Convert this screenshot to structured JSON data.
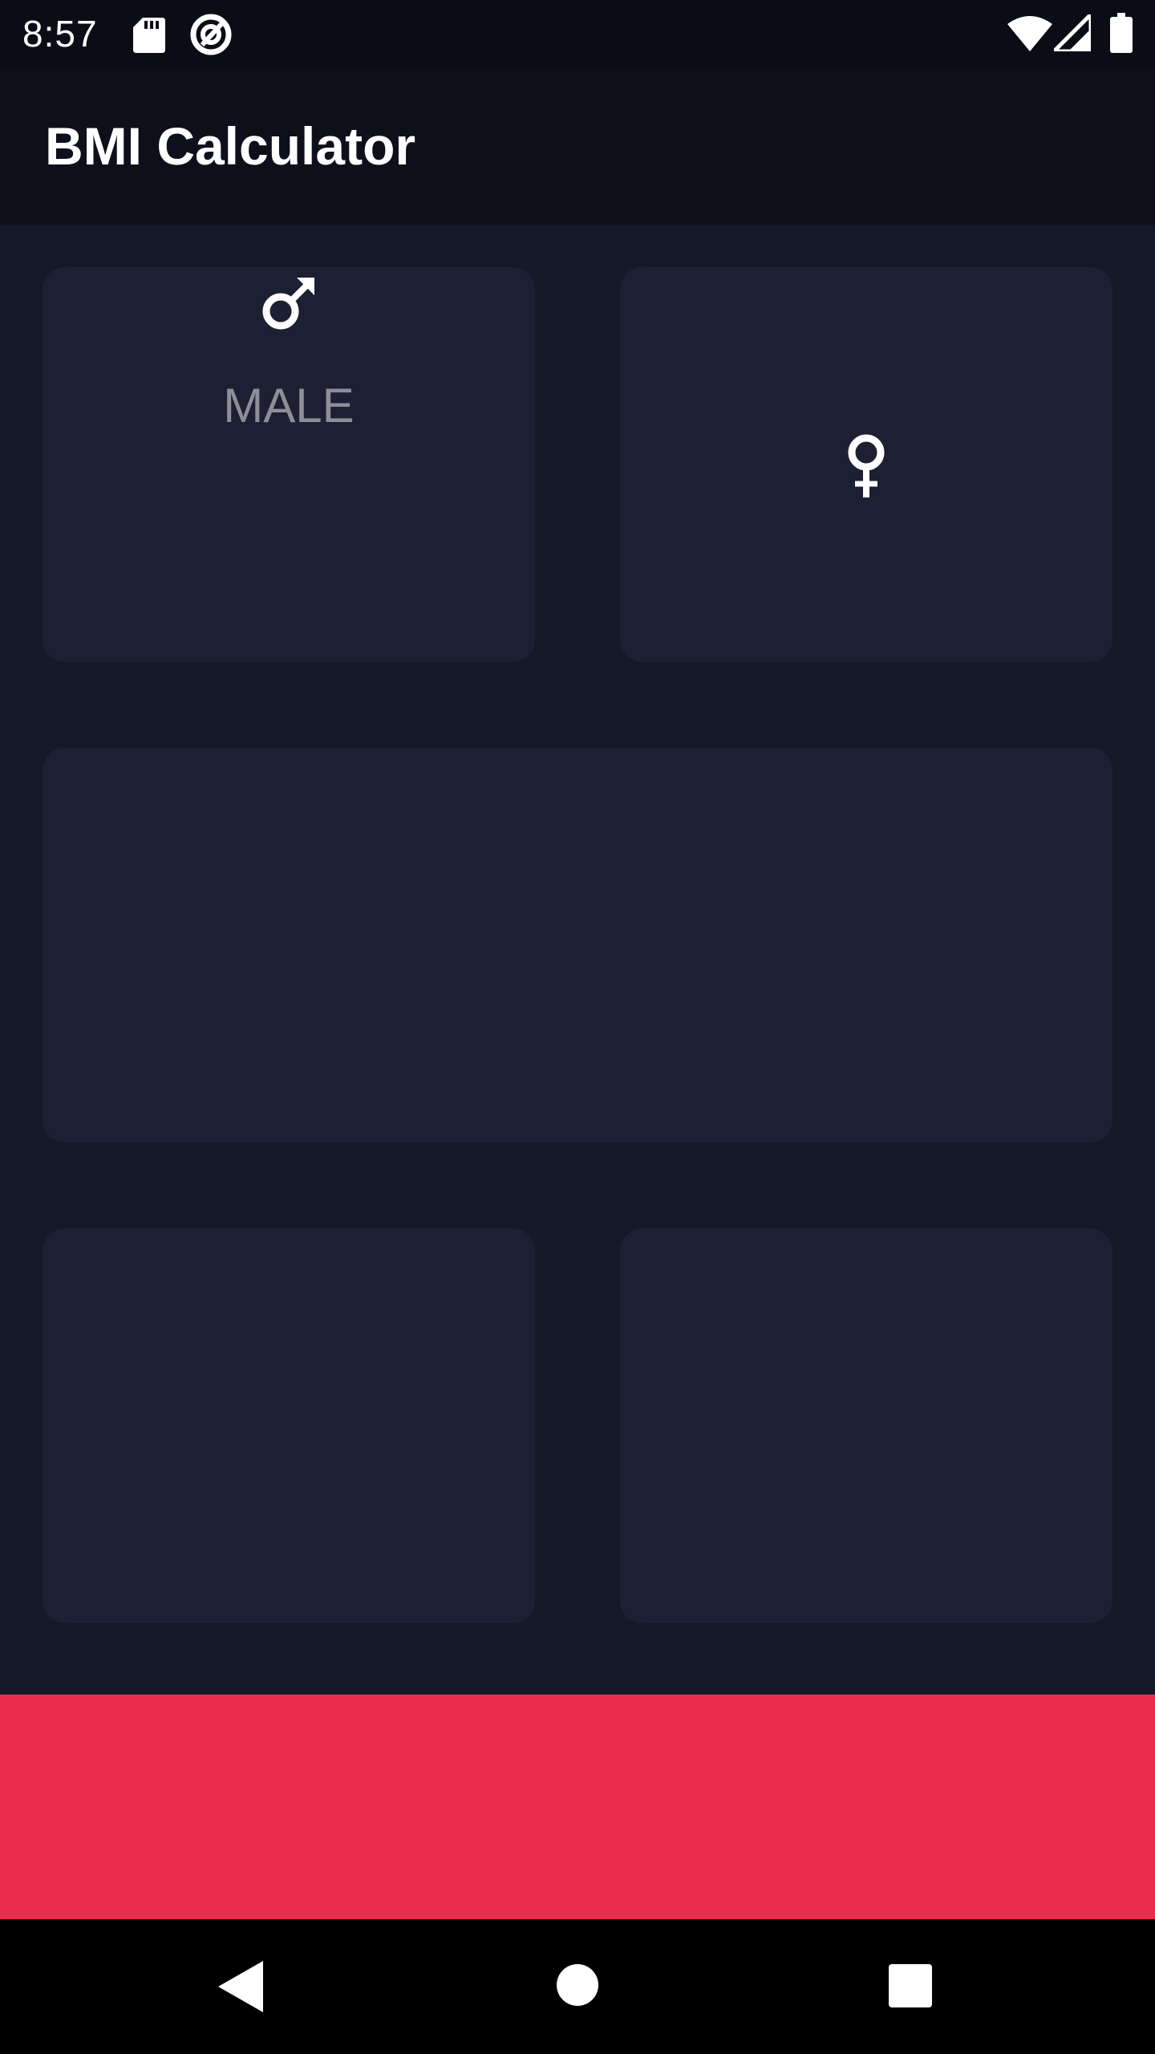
{
  "status_bar": {
    "time": "8:57",
    "left_icons": [
      "sd-card-icon",
      "data-saver-icon"
    ],
    "right_icons": [
      "wifi-icon",
      "signal-icon",
      "battery-icon"
    ]
  },
  "app_bar": {
    "title": "BMI Calculator"
  },
  "gender_cards": {
    "male": {
      "label": "MALE",
      "icon": "male-icon"
    },
    "female": {
      "icon": "female-icon"
    }
  },
  "colors": {
    "background": "#151827",
    "app_bar": "#0d0f1b",
    "card": "#1d1f33",
    "label": "#8d8e98",
    "accent": "#eb2d4f"
  },
  "navigation": {
    "buttons": [
      "back-icon",
      "home-icon",
      "recents-icon"
    ]
  }
}
